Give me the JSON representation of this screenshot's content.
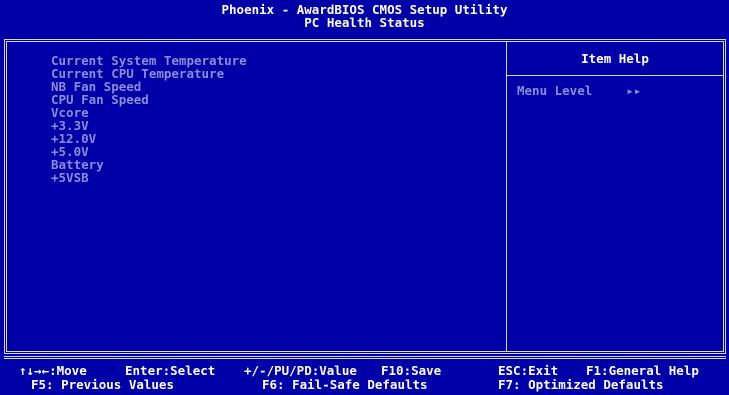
{
  "header": {
    "title": "Phoenix - AwardBIOS CMOS Setup Utility",
    "subtitle": "PC Health Status"
  },
  "items": [
    "Current System Temperature",
    "Current CPU Temperature",
    "NB Fan Speed",
    "CPU Fan Speed",
    "Vcore",
    "+3.3V",
    "+12.0V",
    "+5.0V",
    "Battery",
    "+5VSB"
  ],
  "help": {
    "title": "Item Help",
    "menu_level_label": "Menu Level",
    "menu_level_value": "▸▸"
  },
  "footer": {
    "row1": {
      "move": "↑↓→←:Move",
      "enter": "Enter:Select",
      "value": "+/-/PU/PD:Value",
      "save": "F10:Save",
      "exit": "ESC:Exit",
      "help": "F1:General Help"
    },
    "row2": {
      "previous": "F5: Previous Values",
      "failsafe": "F6: Fail-Safe Defaults",
      "optimized": "F7: Optimized Defaults"
    }
  },
  "colors": {
    "background": "#0000a8",
    "text": "#ffffff",
    "item_text": "#8c8cd8",
    "frame": "#d8d8d8"
  }
}
